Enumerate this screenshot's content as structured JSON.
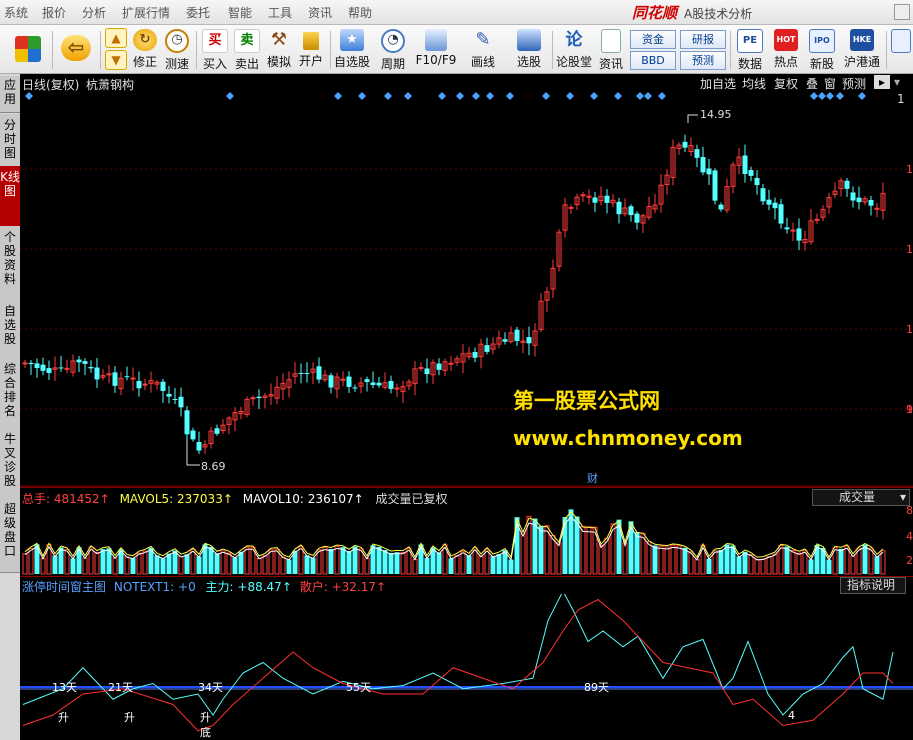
{
  "menu": {
    "items": [
      "系统",
      "报价",
      "分析",
      "扩展行情",
      "委托",
      "智能",
      "工具",
      "资讯",
      "帮助"
    ],
    "brand": "同花顺",
    "subtitle": "A股技术分析"
  },
  "toolbar": {
    "buttons": [
      {
        "label": "",
        "icon": "windows-logo-icon"
      },
      {
        "label": "",
        "icon": "back-arrow-icon"
      },
      {
        "label": "",
        "icon": "up-down-arrows-icon"
      },
      {
        "label": "修正",
        "icon": "revise-icon"
      },
      {
        "label": "测速",
        "icon": "speed-clock-icon"
      },
      {
        "label": "买入",
        "icon": "buy-icon",
        "glyph": "买"
      },
      {
        "label": "卖出",
        "icon": "sell-icon",
        "glyph": "卖"
      },
      {
        "label": "模拟",
        "icon": "hammer-icon"
      },
      {
        "label": "开户",
        "icon": "lock-icon"
      },
      {
        "label": "自选股",
        "icon": "star-folder-icon"
      },
      {
        "label": "周期",
        "icon": "clock-cycle-icon"
      },
      {
        "label": "F10/F9",
        "icon": "f10-icon"
      },
      {
        "label": "画线",
        "icon": "pencil-icon"
      },
      {
        "label": "选股",
        "icon": "stock-select-icon"
      },
      {
        "label": "论股堂",
        "icon": "forum-icon",
        "glyph": "论"
      },
      {
        "label": "资讯",
        "icon": "news-icon"
      },
      {
        "label": "数据",
        "icon": "data-icon",
        "glyph": "PE"
      },
      {
        "label": "热点",
        "icon": "hot-icon",
        "glyph": "HOT"
      },
      {
        "label": "新股",
        "icon": "ipo-icon",
        "glyph": "IPO"
      },
      {
        "label": "沪港通",
        "icon": "hk-connect-icon",
        "glyph": "HKE"
      }
    ],
    "pills": [
      "资金",
      "研报",
      "BBD",
      "预测"
    ]
  },
  "sidebar": {
    "tabs": [
      "应用",
      "分时图",
      "K线图",
      "个股资料",
      "自选股",
      "综合排名",
      "牛叉诊股",
      "超级盘口"
    ],
    "active": 2
  },
  "chart_header": {
    "title": "日线(复权)",
    "stock": "杭萧钢构",
    "right_buttons": [
      "加自选",
      "均线",
      "复权",
      "叠",
      "窗",
      "预测"
    ]
  },
  "price_chart": {
    "high_label": "14.95",
    "low_label": "8.69",
    "axis_labels": [
      "1",
      "1",
      "1",
      "1",
      "9"
    ],
    "marker": "财",
    "colors": {
      "up": "#ff3c3c",
      "down": "#54ffff",
      "diamond": "#4aa3ff"
    }
  },
  "volume_panel": {
    "total_label": "总手:",
    "total_value": "481452↑",
    "ma5_label": "MAVOL5:",
    "ma5_value": "237033↑",
    "ma10_label": "MAVOL10:",
    "ma10_value": "236107↑",
    "note": "成交量已复权",
    "dropdown": "成交量",
    "axis_labels": [
      "8",
      "4",
      "2"
    ]
  },
  "indicator_panel": {
    "name": "涨停时间窗主图",
    "notext": "NOTEXT1: +0",
    "main_label": "主力:",
    "main_value": "+88.47↑",
    "retail_label": "散户:",
    "retail_value": "+32.17↑",
    "button": "指标说明",
    "day_labels": [
      "13天",
      "21天",
      "34天",
      "55天",
      "89天"
    ],
    "signal_labels": [
      "升",
      "升",
      "升",
      "底",
      "4"
    ]
  },
  "watermark": {
    "line1": "第一股票公式网",
    "line2": "www.chnmoney.com"
  }
}
